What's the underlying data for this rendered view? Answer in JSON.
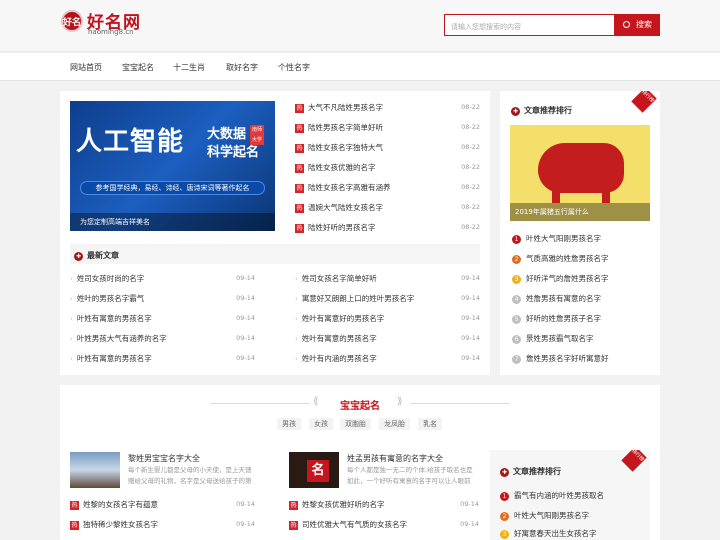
{
  "header": {
    "logo_seal": "好名",
    "logo_title": "好名网",
    "logo_sub": "haoming8.cn",
    "search_placeholder": "请输入您想搜索的内容",
    "search_button": "搜索"
  },
  "nav": {
    "items": [
      "网站首页",
      "宝宝起名",
      "十二生肖",
      "取好名字",
      "个性名字"
    ]
  },
  "banner": {
    "big": "人工智能",
    "sub1": "大数据",
    "sub2": "科学起名",
    "tag": "南师大学",
    "bar": "参考国学经典，易经、诗经、唐诗宋词等著作起名",
    "caption": "为您定制高端吉祥美名"
  },
  "hot_list": {
    "hot_label": "热",
    "items": [
      {
        "title": "大气不凡陆姓男孩名字",
        "date": "08-22"
      },
      {
        "title": "陆姓男孩名字简单好听",
        "date": "08-22"
      },
      {
        "title": "陆姓女孩名字独特大气",
        "date": "08-22"
      },
      {
        "title": "陆姓女孩优雅的名字",
        "date": "08-22"
      },
      {
        "title": "陆姓女孩名字高雅有涵养",
        "date": "08-22"
      },
      {
        "title": "温婉大气陆姓女孩名字",
        "date": "08-22"
      },
      {
        "title": "陆姓好听的男孩名字",
        "date": "08-22"
      }
    ]
  },
  "latest": {
    "title": "最新文章",
    "left": [
      {
        "title": "姓司女孩时尚的名字",
        "date": "09-14"
      },
      {
        "title": "姓叶的男孩名字霸气",
        "date": "09-14"
      },
      {
        "title": "叶姓有寓意的男孩名字",
        "date": "09-14"
      },
      {
        "title": "叶姓男孩大气有涵养的名字",
        "date": "09-14"
      },
      {
        "title": "叶姓有寓意的男孩名字",
        "date": "09-14"
      }
    ],
    "right": [
      {
        "title": "姓司女孩名字简单好听",
        "date": "09-14"
      },
      {
        "title": "寓意好又朗朗上口的姓叶男孩名字",
        "date": "09-14"
      },
      {
        "title": "姓叶有寓意好的男孩名字",
        "date": "09-14"
      },
      {
        "title": "姓叶有寓意的男孩名字",
        "date": "09-14"
      },
      {
        "title": "姓叶有内涵的男孩名字",
        "date": "09-14"
      }
    ]
  },
  "rank": {
    "title": "文章推荐排行",
    "ribbon": "排行榜",
    "image_caption": "2019年属猪五行属什么",
    "items": [
      {
        "num": "1",
        "title": "叶姓大气阳刚男孩名字"
      },
      {
        "num": "2",
        "title": "气质高雅的姓詹男孩名字"
      },
      {
        "num": "3",
        "title": "好听洋气的詹姓男孩名字"
      },
      {
        "num": "4",
        "title": "姓詹男孩有寓意的名字"
      },
      {
        "num": "5",
        "title": "好听的姓詹男孩子名字"
      },
      {
        "num": "6",
        "title": "景姓男孩霸气取名字"
      },
      {
        "num": "7",
        "title": "詹姓男孩名字好听寓意好"
      }
    ]
  },
  "baby_section": {
    "title": "宝宝起名",
    "tags": [
      "男孩",
      "女孩",
      "双胞胎",
      "龙凤胎",
      "乳名"
    ]
  },
  "cards": [
    {
      "title": "黎姓男宝宝名字大全",
      "desc1": "每个新生婴儿都是父母的小天使，是上天馈",
      "desc2": "赠给父母的礼物，名字是父母送给孩子的第",
      "rows": [
        {
          "title": "姓黎的女孩名字有蕴意",
          "date": "09-14"
        },
        {
          "title": "独特稀少黎姓女孩名字",
          "date": "09-14"
        }
      ]
    },
    {
      "title": "姓孟男孩有寓意的名字大全",
      "desc1": "每个人都是独一无二的个体,给孩子取名也是",
      "desc2": "如此，一个好听有寓意的名字可以让人眼前",
      "thumb_text": "名",
      "rows": [
        {
          "title": "姓黎女孩优雅好听的名字",
          "date": "09-14"
        },
        {
          "title": "司姓优雅大气有气质的女孩名字",
          "date": "09-14"
        }
      ]
    }
  ],
  "rank2": {
    "title": "文章推荐排行",
    "ribbon": "排行榜",
    "items": [
      {
        "num": "1",
        "title": "霸气有内涵的叶姓男孩取名"
      },
      {
        "num": "2",
        "title": "叶姓大气阳刚男孩名字"
      },
      {
        "num": "3",
        "title": "好寓意春天出生女孩名字"
      }
    ]
  },
  "colors": {
    "brand": "#c5161d",
    "rank2": "#e36c21",
    "rank3": "#efb11b"
  }
}
